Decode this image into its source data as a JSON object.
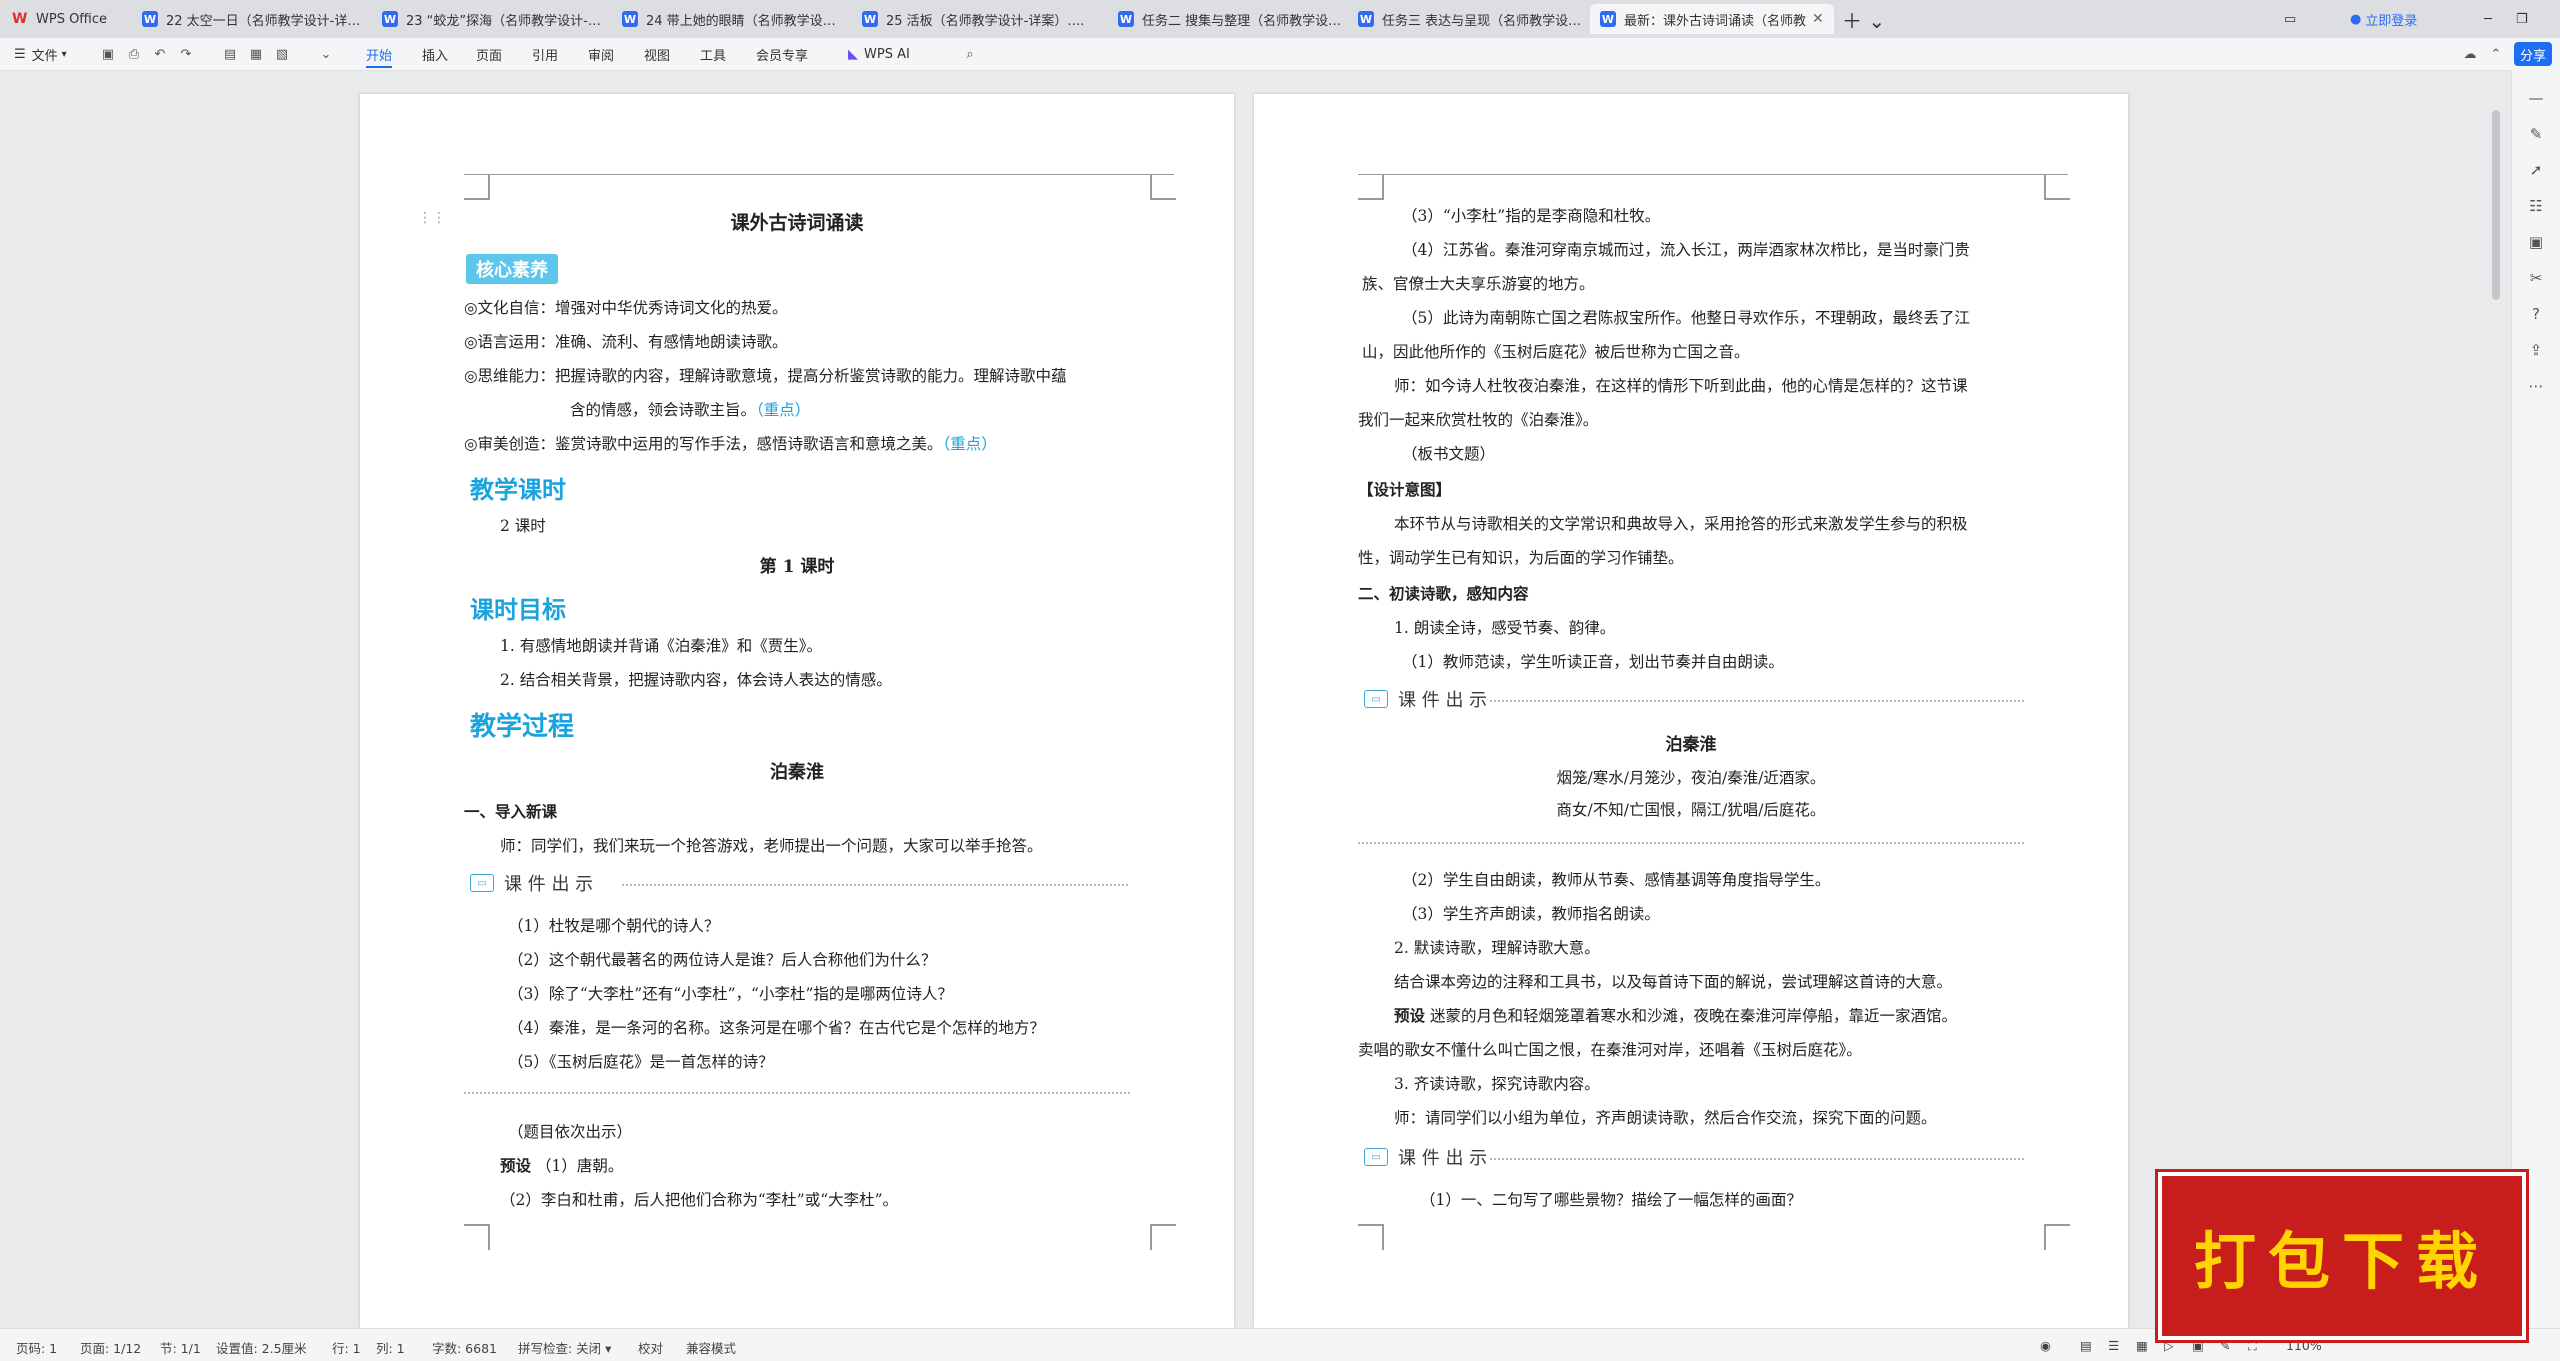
{
  "tabs": [
    {
      "label": "WPS Office",
      "kind": "home"
    },
    {
      "label": "22 太空一日（名师教学设计-详案）",
      "kind": "doc"
    },
    {
      "label": "23 “蛟龙”探海（名师教学设计-详案）",
      "kind": "doc"
    },
    {
      "label": "24 带上她的眼睛（名师教学设计-详案）",
      "kind": "doc"
    },
    {
      "label": "25 活板（名师教学设计-详案）.doc",
      "kind": "doc"
    },
    {
      "label": "任务二 搜集与整理（名师教学设计-详案）",
      "kind": "doc"
    },
    {
      "label": "任务三 表达与呈现（名师教学设计-详案）",
      "kind": "doc"
    },
    {
      "label": "最新：课外古诗词诵读（名师教",
      "kind": "doc"
    }
  ],
  "titlebar": {
    "login": "立即登录"
  },
  "menu": {
    "file": "文件",
    "items": [
      "开始",
      "插入",
      "页面",
      "引用",
      "审阅",
      "视图",
      "工具",
      "会员专享"
    ],
    "ai": "WPS AI",
    "share": "分享"
  },
  "left_page": {
    "title": "课外古诗词诵读",
    "core_badge": "核心素养",
    "core_items": [
      {
        "text": "◎文化自信：增强对中华优秀诗词文化的热爱。",
        "tag": ""
      },
      {
        "text": "◎语言运用：准确、流利、有感情地朗读诗歌。",
        "tag": ""
      },
      {
        "text": "◎思维能力：把握诗歌的内容，理解诗歌意境，提高分析鉴赏诗歌的能力。理解诗歌中蕴",
        "tag": ""
      },
      {
        "text": "含的情感，领会诗歌主旨。",
        "tag": "（重点）"
      },
      {
        "text": "◎审美创造：鉴赏诗歌中运用的写作手法，感悟诗歌语言和意境之美。",
        "tag": "（重点）"
      }
    ],
    "h_hours": "教学课时",
    "hours": "2 课时",
    "lesson1": "第 1 课时",
    "h_goals": "课时目标",
    "goals": [
      "1. 有感情地朗读并背诵《泊秦淮》和《贾生》。",
      "2. 结合相关背景，把握诗歌内容，体会诗人表达的情感。"
    ],
    "h_process": "教学过程",
    "poem_title": "泊秦淮",
    "sec1": "一、导入新课",
    "sec1_text": "师：同学们，我们来玩一个抢答游戏，老师提出一个问题，大家可以举手抢答。",
    "banner": "课 件 出 示",
    "questions": [
      "（1）杜牧是哪个朝代的诗人？",
      "（2）这个朝代最著名的两位诗人是谁？后人合称他们为什么？",
      "（3）除了“大李杜”还有“小李杜”，“小李杜”指的是哪两位诗人？",
      "（4）秦淮，是一条河的名称。这条河是在哪个省？在古代它是个怎样的地方？",
      "（5）《玉树后庭花》是一首怎样的诗？"
    ],
    "note": "（题目依次出示）",
    "preset_label": "预设",
    "preset1": "（1）唐朝。",
    "preset2": "（2）李白和杜甫，后人把他们合称为“李杜”或“大李杜”。"
  },
  "right_page": {
    "lines": [
      "（3）“小李杜”指的是李商隐和杜牧。",
      "（4）江苏省。秦淮河穿南京城而过，流入长江，两岸酒家林次栉比，是当时豪门贵",
      "族、官僚士大夫享乐游宴的地方。",
      "（5）此诗为南朝陈亡国之君陈叔宝所作。他整日寻欢作乐，不理朝政，最终丢了江",
      "山，因此他所作的《玉树后庭花》被后世称为亡国之音。",
      "师：如今诗人杜牧夜泊秦淮，在这样的情形下听到此曲，他的心情是怎样的？这节课",
      "我们一起来欣赏杜牧的《泊秦淮》。",
      "（板书文题）"
    ],
    "design_label": "【设计意图】",
    "design": [
      "本环节从与诗歌相关的文学常识和典故导入，采用抢答的形式来激发学生参与的积极",
      "性，调动学生已有知识，为后面的学习作铺垫。"
    ],
    "sec2": "二、初读诗歌，感知内容",
    "read1": "1. 朗读全诗，感受节奏、韵律。",
    "read1a": "（1）教师范读，学生听读正音，划出节奏并自由朗读。",
    "banner": "课 件 出 示",
    "poem_title": "泊秦淮",
    "poem_lines": [
      "烟笼/寒水/月笼沙，夜泊/秦淮/近酒家。",
      "商女/不知/亡国恨，隔江/犹唱/后庭花。"
    ],
    "after": [
      "（2）学生自由朗读，教师从节奏、感情基调等角度指导学生。",
      "（3）学生齐声朗读，教师指名朗读。",
      "2. 默读诗歌，理解诗歌大意。",
      "结合课本旁边的注释和工具书，以及每首诗下面的解说，尝试理解这首诗的大意。"
    ],
    "preset_label": "预设",
    "preset_text": "迷蒙的月色和轻烟笼罩着寒水和沙滩，夜晚在秦淮河岸停船，靠近一家酒馆。",
    "preset_cont": "卖唱的歌女不懂什么叫亡国之恨，在秦淮河对岸，还唱着《玉树后庭花》。",
    "read3": "3. 齐读诗歌，探究诗歌内容。",
    "teacher": "师：请同学们以小组为单位，齐声朗读诗歌，然后合作交流，探究下面的问题。",
    "banner2": "课 件 出 示",
    "q1": "（1）一、二句写了哪些景物？描绘了一幅怎样的画面？"
  },
  "status": {
    "page_code": "页码: 1",
    "page": "页面: 1/12",
    "section": "节: 1/1",
    "setting": "设置值: 2.5厘米",
    "row": "行: 1",
    "col": "列: 1",
    "words": "字数: 6681",
    "spell": "拼写检查: 关闭",
    "proof": "校对",
    "compat": "兼容模式",
    "zoom": "110%"
  },
  "badge": "打包下载",
  "colors": {
    "accent": "#1d6ef2",
    "heading": "#1aa3dd",
    "badge_bg": "#c81d1d",
    "badge_text": "#ffd400"
  }
}
